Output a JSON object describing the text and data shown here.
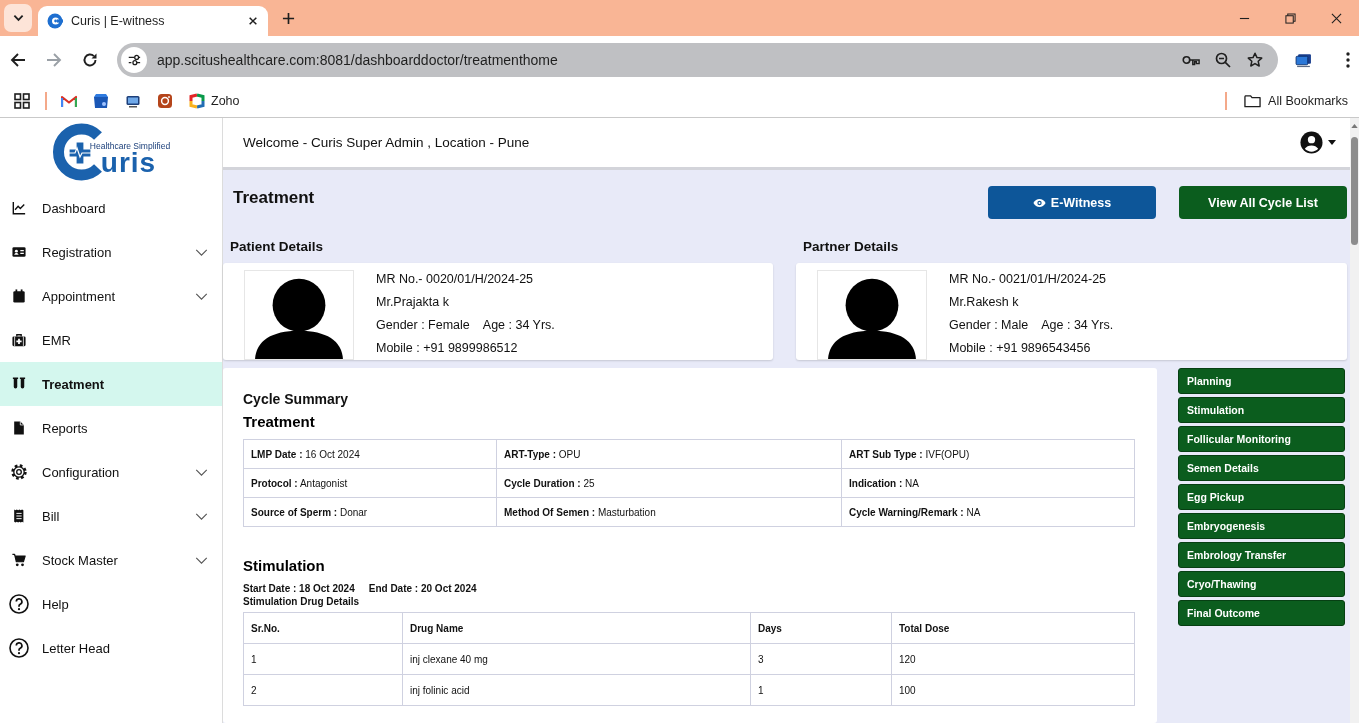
{
  "browser": {
    "tabs": [
      {
        "title": "Curis | E-witness",
        "selected": true
      }
    ],
    "nav_buttons": [
      {
        "kind": "back",
        "disabled": false
      },
      {
        "kind": "forward",
        "disabled": true
      },
      {
        "kind": "reload",
        "disabled": false
      }
    ],
    "url": "app.scitushealthcare.com:8081/dashboarddoctor/treatmenthome",
    "bookmarks": [
      {
        "label": "Zoho"
      }
    ],
    "all_bookmarks": "All Bookmarks"
  },
  "logo": {
    "wordmark": "uris",
    "tagline": "Healthcare Simplified"
  },
  "sidebar": {
    "items": [
      {
        "label": "Dashboard",
        "selected": false,
        "has_submenu": false
      },
      {
        "label": "Registration",
        "selected": false,
        "has_submenu": true
      },
      {
        "label": "Appointment",
        "selected": false,
        "has_submenu": true
      },
      {
        "label": "EMR",
        "selected": false,
        "has_submenu": false
      },
      {
        "label": "Treatment",
        "selected": true,
        "has_submenu": false
      },
      {
        "label": "Reports",
        "selected": false,
        "has_submenu": false
      },
      {
        "label": "Configuration",
        "selected": false,
        "has_submenu": true
      },
      {
        "label": "Bill",
        "selected": false,
        "has_submenu": true
      },
      {
        "label": "Stock Master",
        "selected": false,
        "has_submenu": true
      },
      {
        "label": "Help",
        "selected": false,
        "has_submenu": false
      },
      {
        "label": "Letter Head",
        "selected": false,
        "has_submenu": false
      }
    ]
  },
  "header": {
    "welcome": "Welcome - Curis Super Admin , Location - Pune"
  },
  "page": {
    "title": "Treatment",
    "actions": [
      {
        "label": "E-Witness",
        "kind": "primary"
      },
      {
        "label": "View All Cycle List",
        "kind": "secondary"
      }
    ]
  },
  "details": [
    {
      "heading": "Patient Details",
      "mr_no": "MR No.- 0020/01/H/2024-25",
      "name": "Mr.Prajakta k",
      "gender": "Gender : Female",
      "age": "Age : 34 Yrs.",
      "mobile": "Mobile : +91 9899986512"
    },
    {
      "heading": "Partner Details",
      "mr_no": "MR No.- 0021/01/H/2024-25",
      "name": "Mr.Rakesh k",
      "gender": "Gender : Male",
      "age": "Age : 34 Yrs.",
      "mobile": "Mobile : +91 9896543456"
    }
  ],
  "cycle_summary": {
    "title": "Cycle Summary",
    "treatment": {
      "heading": "Treatment",
      "rows": [
        [
          "**LMP Date :** 16 Oct 2024",
          "**ART-Type :** OPU",
          "**ART Sub Type :** IVF(OPU)"
        ],
        [
          "**Protocol :** Antagonist",
          "**Cycle Duration :** 25",
          "**Indication :** NA"
        ],
        [
          "**Source of Sperm :** Donar",
          "**Method Of Semen :** Masturbation",
          "**Cycle Warning/Remark :** NA"
        ]
      ]
    },
    "stimulation": {
      "heading": "Stimulation",
      "start_date": "Start Date : 18 Oct 2024",
      "end_date": "End Date : 20 Oct 2024",
      "drug_heading": "Stimulation Drug Details",
      "columns": [
        "Sr.No.",
        "Drug Name",
        "Days",
        "Total Dose"
      ],
      "rows": [
        [
          "1",
          "inj clexane 40 mg",
          "3",
          "120"
        ],
        [
          "2",
          "inj folinic acid",
          "1",
          "100"
        ]
      ]
    }
  },
  "steps": [
    "Planning",
    "Stimulation",
    "Follicular Monitoring",
    "Semen Details",
    "Egg Pickup",
    "Embryogenesis",
    "Embrology Transfer",
    "Cryo/Thawing",
    "Final Outcome"
  ]
}
